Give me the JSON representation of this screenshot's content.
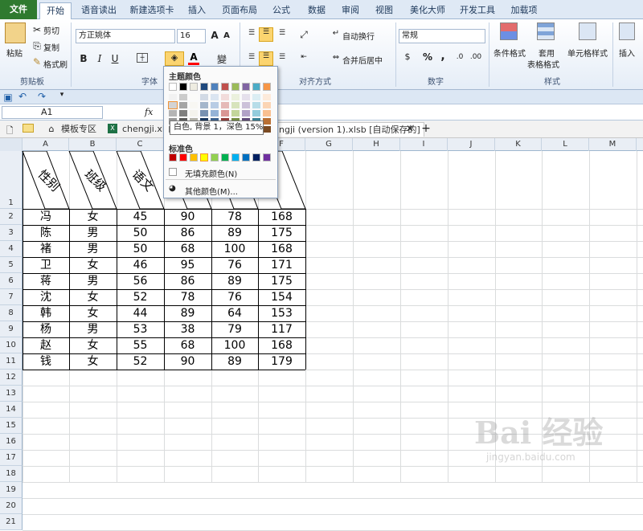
{
  "tabs": [
    "文件",
    "开始",
    "语音读出",
    "新建选项卡",
    "插入",
    "页面布局",
    "公式",
    "数据",
    "审阅",
    "视图",
    "美化大师",
    "开发工具",
    "加载项"
  ],
  "clipboard": {
    "paste": "粘贴",
    "cut": "剪切",
    "copy": "复制",
    "format_painter": "格式刷",
    "group": "剪贴板"
  },
  "font": {
    "name": "方正姚体",
    "size": "16",
    "bold": "B",
    "italic": "I",
    "underline": "U",
    "group": "字体",
    "wen": "變"
  },
  "alignment": {
    "wrap": "自动换行",
    "merge": "合并后居中",
    "group": "对齐方式"
  },
  "number": {
    "format": "常规",
    "percent": "%",
    "comma": ",",
    "group": "数字"
  },
  "styles": {
    "conditional": "条件格式",
    "table1": "套用",
    "table2": "表格格式",
    "cell": "单元格样式",
    "group": "样式"
  },
  "insert": {
    "label": "插入"
  },
  "formula_bar": {
    "cell": "A1",
    "fx": "fx"
  },
  "doc_tabs": [
    "模板专区",
    "chengji.xlsx",
    "ngji (version 1).xlsb [自动保存的]"
  ],
  "columns": [
    "A",
    "B",
    "C",
    "D",
    "E",
    "F",
    "G",
    "H",
    "I",
    "J",
    "K",
    "L",
    "M"
  ],
  "rows": [
    "1",
    "2",
    "3",
    "4",
    "5",
    "6",
    "7",
    "8",
    "9",
    "10",
    "11",
    "12",
    "13",
    "14",
    "15",
    "16",
    "17",
    "18",
    "19",
    "20",
    "21"
  ],
  "header_cells": [
    "性别",
    "班级",
    "语文"
  ],
  "table_rows": [
    [
      "冯",
      "女",
      "45",
      "90",
      "78",
      "168"
    ],
    [
      "陈",
      "男",
      "50",
      "86",
      "89",
      "175"
    ],
    [
      "褚",
      "男",
      "50",
      "68",
      "100",
      "168"
    ],
    [
      "卫",
      "女",
      "46",
      "95",
      "76",
      "171"
    ],
    [
      "蒋",
      "男",
      "56",
      "86",
      "89",
      "175"
    ],
    [
      "沈",
      "女",
      "52",
      "78",
      "76",
      "154"
    ],
    [
      "韩",
      "女",
      "44",
      "89",
      "64",
      "153"
    ],
    [
      "杨",
      "男",
      "53",
      "38",
      "79",
      "117"
    ],
    [
      "赵",
      "女",
      "55",
      "68",
      "100",
      "168"
    ],
    [
      "钱",
      "女",
      "52",
      "90",
      "89",
      "179"
    ]
  ],
  "palette": {
    "theme_title": "主题颜色",
    "standard_title": "标准色",
    "no_fill": "无填充颜色(N)",
    "more": "其他颜色(M)...",
    "tooltip": "白色, 背景 1，深色 15%",
    "theme_colors": [
      "#ffffff",
      "#000000",
      "#eeece1",
      "#1f497d",
      "#4f81bd",
      "#c0504d",
      "#9bbb59",
      "#8064a2",
      "#4bacc6",
      "#f79646",
      "#4472c4",
      "#70ad47"
    ],
    "standard_colors": [
      "#c00000",
      "#ff0000",
      "#ffc000",
      "#ffff00",
      "#92d050",
      "#00b050",
      "#00b0f0",
      "#0070c0",
      "#002060",
      "#7030a0"
    ]
  },
  "watermark": {
    "brand": "Bai 经验",
    "url": "jingyan.baidu.com"
  }
}
